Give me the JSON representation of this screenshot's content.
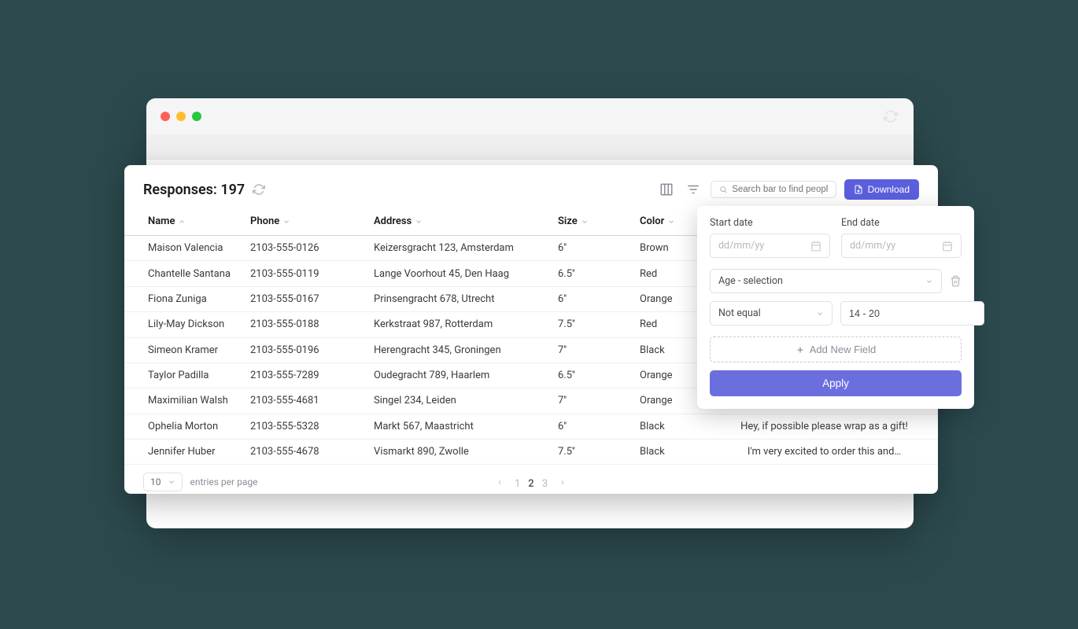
{
  "panel": {
    "title": "Responses: 197",
    "search_placeholder": "Search bar to find people",
    "download_label": "Download"
  },
  "columns": {
    "name": "Name",
    "phone": "Phone",
    "address": "Address",
    "size": "Size",
    "color": "Color"
  },
  "rows": [
    {
      "name": "Maison Valencia",
      "phone": "2103-555-0126",
      "address": "Keizersgracht 123, Amsterdam",
      "size": "6''",
      "color": "Brown",
      "notes": ""
    },
    {
      "name": "Chantelle Santana",
      "phone": "2103-555-0119",
      "address": "Lange Voorhout 45, Den Haag",
      "size": "6.5''",
      "color": "Red",
      "notes": ""
    },
    {
      "name": "Fiona Zuniga",
      "phone": "2103-555-0167",
      "address": "Prinsengracht 678, Utrecht",
      "size": "6''",
      "color": "Orange",
      "notes": ""
    },
    {
      "name": "Lily-May Dickson",
      "phone": "2103-555-0188",
      "address": "Kerkstraat 987, Rotterdam",
      "size": "7.5''",
      "color": "Red",
      "notes": ""
    },
    {
      "name": "Simeon Kramer",
      "phone": "2103-555-0196",
      "address": "Herengracht 345, Groningen",
      "size": "7''",
      "color": "Black",
      "notes": ""
    },
    {
      "name": "Taylor Padilla",
      "phone": "2103-555-7289",
      "address": "Oudegracht 789, Haarlem",
      "size": "6.5''",
      "color": "Orange",
      "notes": ""
    },
    {
      "name": "Maximilian Walsh",
      "phone": "2103-555-4681",
      "address": "Singel 234, Leiden",
      "size": "7''",
      "color": "Orange",
      "notes": ""
    },
    {
      "name": "Ophelia Morton",
      "phone": "2103-555-5328",
      "address": "Markt 567, Maastricht",
      "size": "6''",
      "color": "Black",
      "notes": "Hey, if possible please wrap as a gift!"
    },
    {
      "name": "Jennifer Huber",
      "phone": "2103-555-4678",
      "address": "Vismarkt 890, Zwolle",
      "size": "7.5''",
      "color": "Black",
      "notes": "I'm very excited to order this and…"
    }
  ],
  "footer": {
    "entries_value": "10",
    "entries_label": "entries per page",
    "pages": [
      "1",
      "2",
      "3"
    ],
    "active_page": "2"
  },
  "filter": {
    "start_label": "Start date",
    "end_label": "End date",
    "date_placeholder": "dd/mm/yy",
    "field_value": "Age - selection",
    "condition_value": "Not equal",
    "range_value": "14 - 20",
    "add_field_label": "Add New Field",
    "apply_label": "Apply"
  }
}
